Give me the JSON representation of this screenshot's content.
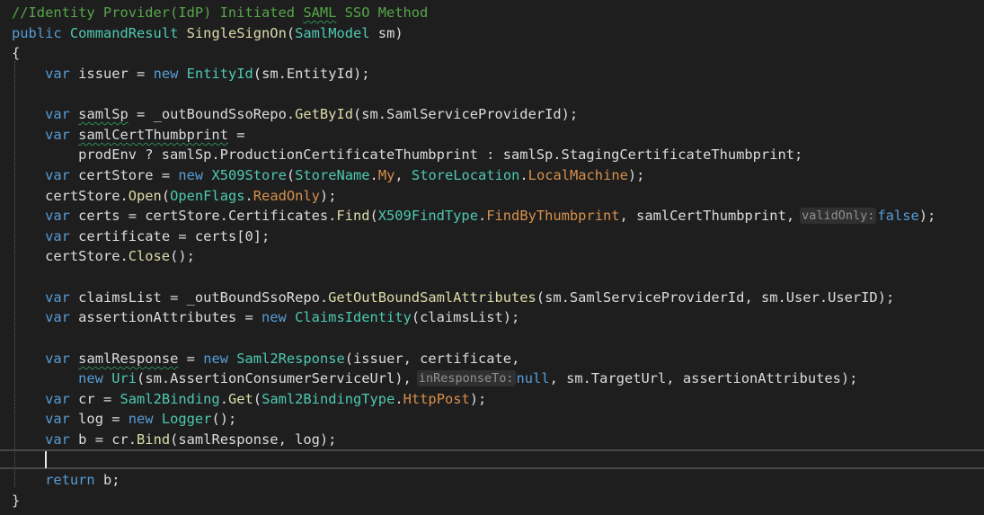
{
  "colors": {
    "background": "#1e1e1e",
    "comment": "#57a64a",
    "keyword": "#569cd6",
    "type": "#4ec9b0",
    "method": "#dcdcaa",
    "enum_member": "#d7904c",
    "plain": "#dcdcdc",
    "hint_text": "#909090"
  },
  "code": {
    "lines": [
      [
        {
          "t": "//Identity Provider(IdP) Initiated ",
          "c": "#57a64a"
        },
        {
          "t": "SAML",
          "c": "#57a64a",
          "u": true
        },
        {
          "t": " SSO Method",
          "c": "#57a64a"
        }
      ],
      [
        {
          "t": "public",
          "c": "#569cd6"
        },
        {
          "t": " ",
          "c": "#dcdcdc"
        },
        {
          "t": "CommandResult",
          "c": "#4ec9b0"
        },
        {
          "t": " ",
          "c": "#dcdcdc"
        },
        {
          "t": "SingleSignOn",
          "c": "#dcdcaa"
        },
        {
          "t": "(",
          "c": "#dcdcdc"
        },
        {
          "t": "SamlModel",
          "c": "#4ec9b0"
        },
        {
          "t": " sm)",
          "c": "#dcdcdc"
        }
      ],
      [
        {
          "t": "{",
          "c": "#dcdcdc"
        }
      ],
      [
        {
          "t": "    ",
          "c": "#dcdcdc"
        },
        {
          "t": "var",
          "c": "#569cd6"
        },
        {
          "t": " issuer = ",
          "c": "#dcdcdc"
        },
        {
          "t": "new",
          "c": "#569cd6"
        },
        {
          "t": " ",
          "c": "#dcdcdc"
        },
        {
          "t": "EntityId",
          "c": "#4ec9b0"
        },
        {
          "t": "(sm.EntityId);",
          "c": "#dcdcdc"
        }
      ],
      [],
      [
        {
          "t": "    ",
          "c": "#dcdcdc"
        },
        {
          "t": "var",
          "c": "#569cd6"
        },
        {
          "t": " ",
          "c": "#dcdcdc"
        },
        {
          "t": "samlSp",
          "c": "#dcdcdc",
          "u": true
        },
        {
          "t": " = _outBoundSsoRepo.",
          "c": "#dcdcdc"
        },
        {
          "t": "GetById",
          "c": "#dcdcaa"
        },
        {
          "t": "(sm.SamlServiceProviderId);",
          "c": "#dcdcdc"
        }
      ],
      [
        {
          "t": "    ",
          "c": "#dcdcdc"
        },
        {
          "t": "var",
          "c": "#569cd6"
        },
        {
          "t": " ",
          "c": "#dcdcdc"
        },
        {
          "t": "samlCertThumbprint",
          "c": "#dcdcdc",
          "u": true
        },
        {
          "t": " =",
          "c": "#dcdcdc"
        }
      ],
      [
        {
          "t": "        prodEnv ? samlSp.ProductionCertificateThumbprint : samlSp.StagingCertificateThumbprint;",
          "c": "#dcdcdc"
        }
      ],
      [
        {
          "t": "    ",
          "c": "#dcdcdc"
        },
        {
          "t": "var",
          "c": "#569cd6"
        },
        {
          "t": " certStore = ",
          "c": "#dcdcdc"
        },
        {
          "t": "new",
          "c": "#569cd6"
        },
        {
          "t": " ",
          "c": "#dcdcdc"
        },
        {
          "t": "X509Store",
          "c": "#4ec9b0"
        },
        {
          "t": "(",
          "c": "#dcdcdc"
        },
        {
          "t": "StoreName",
          "c": "#4ec9b0"
        },
        {
          "t": ".",
          "c": "#dcdcdc"
        },
        {
          "t": "My",
          "c": "#d7904c"
        },
        {
          "t": ", ",
          "c": "#dcdcdc"
        },
        {
          "t": "StoreLocation",
          "c": "#4ec9b0"
        },
        {
          "t": ".",
          "c": "#dcdcdc"
        },
        {
          "t": "LocalMachine",
          "c": "#d7904c"
        },
        {
          "t": ");",
          "c": "#dcdcdc"
        }
      ],
      [
        {
          "t": "    certStore.",
          "c": "#dcdcdc"
        },
        {
          "t": "Open",
          "c": "#dcdcaa"
        },
        {
          "t": "(",
          "c": "#dcdcdc"
        },
        {
          "t": "OpenFlags",
          "c": "#4ec9b0"
        },
        {
          "t": ".",
          "c": "#dcdcdc"
        },
        {
          "t": "ReadOnly",
          "c": "#d7904c"
        },
        {
          "t": ");",
          "c": "#dcdcdc"
        }
      ],
      [
        {
          "t": "    ",
          "c": "#dcdcdc"
        },
        {
          "t": "var",
          "c": "#569cd6"
        },
        {
          "t": " certs = certStore.Certificates.",
          "c": "#dcdcdc"
        },
        {
          "t": "Find",
          "c": "#dcdcaa"
        },
        {
          "t": "(",
          "c": "#dcdcdc"
        },
        {
          "t": "X509FindType",
          "c": "#4ec9b0"
        },
        {
          "t": ".",
          "c": "#dcdcdc"
        },
        {
          "t": "FindByThumbprint",
          "c": "#d7904c"
        },
        {
          "t": ", samlCertThumbprint,",
          "c": "#dcdcdc"
        },
        {
          "t": "validOnly:",
          "hint": true
        },
        {
          "t": "false",
          "c": "#569cd6"
        },
        {
          "t": ");",
          "c": "#dcdcdc"
        }
      ],
      [
        {
          "t": "    ",
          "c": "#dcdcdc"
        },
        {
          "t": "var",
          "c": "#569cd6"
        },
        {
          "t": " certificate = certs[0];",
          "c": "#dcdcdc"
        }
      ],
      [
        {
          "t": "    certStore.",
          "c": "#dcdcdc"
        },
        {
          "t": "Close",
          "c": "#dcdcaa"
        },
        {
          "t": "();",
          "c": "#dcdcdc"
        }
      ],
      [],
      [
        {
          "t": "    ",
          "c": "#dcdcdc"
        },
        {
          "t": "var",
          "c": "#569cd6"
        },
        {
          "t": " claimsList = _outBoundSsoRepo.",
          "c": "#dcdcdc"
        },
        {
          "t": "GetOutBoundSamlAttributes",
          "c": "#dcdcaa"
        },
        {
          "t": "(sm.SamlServiceProviderId, sm.User.UserID);",
          "c": "#dcdcdc"
        }
      ],
      [
        {
          "t": "    ",
          "c": "#dcdcdc"
        },
        {
          "t": "var",
          "c": "#569cd6"
        },
        {
          "t": " assertionAttributes = ",
          "c": "#dcdcdc"
        },
        {
          "t": "new",
          "c": "#569cd6"
        },
        {
          "t": " ",
          "c": "#dcdcdc"
        },
        {
          "t": "ClaimsIdentity",
          "c": "#4ec9b0"
        },
        {
          "t": "(claimsList);",
          "c": "#dcdcdc"
        }
      ],
      [],
      [
        {
          "t": "    ",
          "c": "#dcdcdc"
        },
        {
          "t": "var",
          "c": "#569cd6"
        },
        {
          "t": " ",
          "c": "#dcdcdc"
        },
        {
          "t": "samlResponse",
          "c": "#dcdcdc",
          "u": true
        },
        {
          "t": " = ",
          "c": "#dcdcdc"
        },
        {
          "t": "new",
          "c": "#569cd6"
        },
        {
          "t": " ",
          "c": "#dcdcdc"
        },
        {
          "t": "Saml2Response",
          "c": "#4ec9b0"
        },
        {
          "t": "(issuer, certificate,",
          "c": "#dcdcdc"
        }
      ],
      [
        {
          "t": "        ",
          "c": "#dcdcdc"
        },
        {
          "t": "new",
          "c": "#569cd6"
        },
        {
          "t": " ",
          "c": "#dcdcdc"
        },
        {
          "t": "Uri",
          "c": "#4ec9b0"
        },
        {
          "t": "(sm.AssertionConsumerServiceUrl),",
          "c": "#dcdcdc"
        },
        {
          "t": "inResponseTo:",
          "hint": true
        },
        {
          "t": "null",
          "c": "#569cd6"
        },
        {
          "t": ", sm.TargetUrl, assertionAttributes);",
          "c": "#dcdcdc"
        }
      ],
      [
        {
          "t": "    ",
          "c": "#dcdcdc"
        },
        {
          "t": "var",
          "c": "#569cd6"
        },
        {
          "t": " cr = ",
          "c": "#dcdcdc"
        },
        {
          "t": "Saml2Binding",
          "c": "#4ec9b0"
        },
        {
          "t": ".",
          "c": "#dcdcdc"
        },
        {
          "t": "Get",
          "c": "#dcdcaa"
        },
        {
          "t": "(",
          "c": "#dcdcdc"
        },
        {
          "t": "Saml2BindingType",
          "c": "#4ec9b0"
        },
        {
          "t": ".",
          "c": "#dcdcdc"
        },
        {
          "t": "HttpPost",
          "c": "#d7904c"
        },
        {
          "t": ");",
          "c": "#dcdcdc"
        }
      ],
      [
        {
          "t": "    ",
          "c": "#dcdcdc"
        },
        {
          "t": "var",
          "c": "#569cd6"
        },
        {
          "t": " log = ",
          "c": "#dcdcdc"
        },
        {
          "t": "new",
          "c": "#569cd6"
        },
        {
          "t": " ",
          "c": "#dcdcdc"
        },
        {
          "t": "Logger",
          "c": "#4ec9b0"
        },
        {
          "t": "();",
          "c": "#dcdcdc"
        }
      ],
      [
        {
          "t": "    ",
          "c": "#dcdcdc"
        },
        {
          "t": "var",
          "c": "#569cd6"
        },
        {
          "t": " b = cr.",
          "c": "#dcdcdc"
        },
        {
          "t": "Bind",
          "c": "#dcdcaa"
        },
        {
          "t": "(samlResponse, log);",
          "c": "#dcdcdc"
        }
      ],
      [],
      [
        {
          "t": "    ",
          "c": "#dcdcdc"
        },
        {
          "t": "return",
          "c": "#569cd6"
        },
        {
          "t": " b;",
          "c": "#dcdcdc"
        }
      ],
      [
        {
          "t": "}",
          "c": "#dcdcdc"
        }
      ]
    ]
  }
}
